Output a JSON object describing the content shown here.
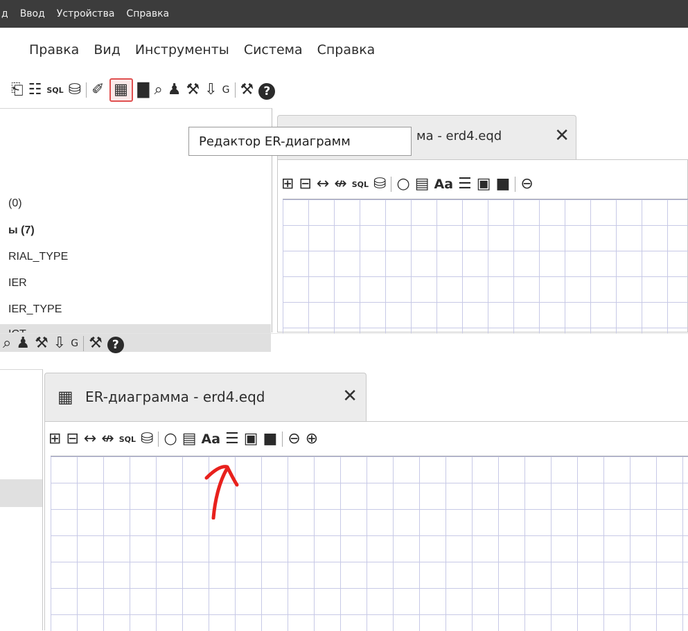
{
  "vbox_menu": [
    "д",
    "Ввод",
    "Устройства",
    "Справка"
  ],
  "app_menu": [
    "Правка",
    "Вид",
    "Инструменты",
    "Система",
    "Справка"
  ],
  "icons": {
    "tab_icon": "er-diagram-icon",
    "help": "?"
  },
  "tooltip": "Редактор ER-диаграмм",
  "top_tab": {
    "title": "ма - erd4.eqd",
    "close": "✕"
  },
  "tree": [
    "(0)",
    "ы (7)",
    "RIAL_TYPE",
    "IER",
    "IER_TYPE",
    "ICT"
  ],
  "bottom_tab": {
    "title": "ER-диаграмма - erd4.eqd",
    "close": "✕"
  },
  "erd_toolbar_labels": {
    "sql": "SQL",
    "font": "Aa",
    "g": "G"
  },
  "annotation_color": "#e8211d"
}
